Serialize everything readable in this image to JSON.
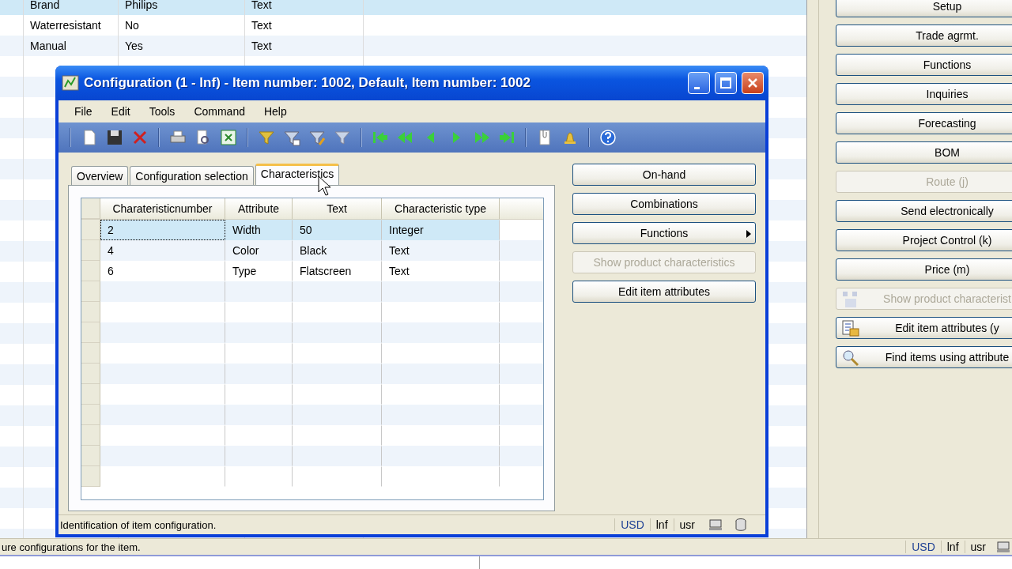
{
  "background_table": {
    "rows": [
      {
        "cells": [
          "Brand",
          "Philips",
          "Text"
        ],
        "selected": true
      },
      {
        "cells": [
          "Waterresistant",
          "No",
          "Text"
        ],
        "selected": false
      },
      {
        "cells": [
          "Manual",
          "Yes",
          "Text"
        ],
        "selected": false
      }
    ]
  },
  "background_buttons": [
    {
      "label": "Setup",
      "disabled": false,
      "kind": "plain"
    },
    {
      "label": "Trade agrmt.",
      "disabled": false,
      "kind": "plain"
    },
    {
      "label": "Functions",
      "disabled": false,
      "kind": "plain"
    },
    {
      "label": "Inquiries",
      "disabled": false,
      "kind": "plain"
    },
    {
      "label": "Forecasting",
      "disabled": false,
      "kind": "plain"
    },
    {
      "label": "BOM",
      "disabled": false,
      "kind": "plain"
    },
    {
      "label": "Route (j)",
      "disabled": true,
      "kind": "plain"
    },
    {
      "label": "Send electronically",
      "disabled": false,
      "kind": "plain"
    },
    {
      "label": "Project Control (k)",
      "disabled": false,
      "kind": "plain"
    },
    {
      "label": "Price (m)",
      "disabled": false,
      "kind": "plain"
    },
    {
      "label": "Show product characterist",
      "disabled": true,
      "kind": "boxes"
    },
    {
      "label": "Edit item attributes (y",
      "disabled": false,
      "kind": "attributes"
    },
    {
      "label": "Find items using attribute",
      "disabled": false,
      "kind": "search"
    }
  ],
  "background_status": {
    "text": "ure configurations for the item.",
    "indicators": [
      "USD",
      "lnf",
      "usr"
    ]
  },
  "dialog": {
    "title": "Configuration (1 - lnf) - Item number: 1002, Default, Item number: 1002",
    "menu": [
      "File",
      "Edit",
      "Tools",
      "Command",
      "Help"
    ],
    "tabs": [
      {
        "label": "Overview",
        "selected": false
      },
      {
        "label": "Configuration selection",
        "selected": false
      },
      {
        "label": "Characteristics",
        "selected": true
      }
    ],
    "table": {
      "columns": [
        "Charateristicnumber",
        "Attribute",
        "Text",
        "Characteristic type"
      ],
      "rows": [
        {
          "cells": [
            "2",
            "Width",
            "50",
            "Integer"
          ],
          "selected": true
        },
        {
          "cells": [
            "4",
            "Color",
            "Black",
            "Text"
          ],
          "selected": false
        },
        {
          "cells": [
            "6",
            "Type",
            "Flatscreen",
            "Text"
          ],
          "selected": false
        }
      ]
    },
    "buttons": [
      {
        "label": "On-hand",
        "disabled": false,
        "submenu": false
      },
      {
        "label": "Combinations",
        "disabled": false,
        "submenu": false
      },
      {
        "label": "Functions",
        "disabled": false,
        "submenu": true
      },
      {
        "label": "Show product characteristics",
        "disabled": true,
        "submenu": false
      },
      {
        "label": "Edit item attributes",
        "disabled": false,
        "submenu": false
      }
    ],
    "status": {
      "text": "Identification of item configuration.",
      "indicators": [
        "USD",
        "lnf",
        "usr"
      ]
    }
  }
}
